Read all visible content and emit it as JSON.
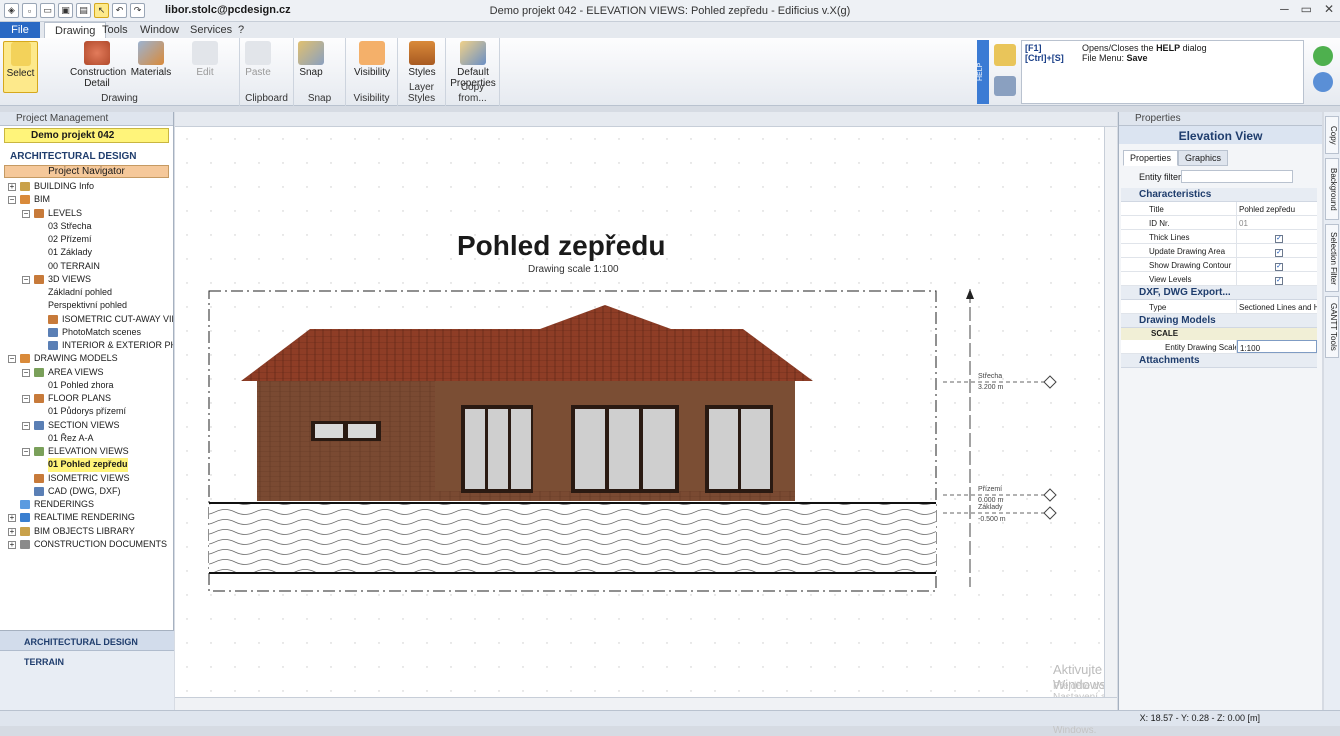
{
  "app": {
    "user": "libor.stolc@pcdesign.cz",
    "window_title": "Demo projekt 042 - ELEVATION VIEWS: Pohled zepředu - Edificius v.X(g)"
  },
  "tabs": [
    "File",
    "Drawing",
    "Tools",
    "Window",
    "Services",
    "?"
  ],
  "ribbon": {
    "select": "Select",
    "construction": "Construction",
    "detail": "Detail",
    "materials": "Materials",
    "edit": "Edit",
    "paste": "Paste",
    "snap": "Snap",
    "visibility": "Visibility",
    "styles": "Styles",
    "default": "Default",
    "properties": "Properties",
    "g_drawing": "Drawing",
    "g_clipboard": "Clipboard",
    "g_snap": "Snap",
    "g_visibility": "Visibility",
    "g_layer": "Layer Styles",
    "g_copy": "Copy from..."
  },
  "help": {
    "strip": "HELP",
    "k1": "[F1]",
    "d1": "Opens/Closes the",
    "d1b": "HELP",
    "d1c": "dialog",
    "k2": "[Ctrl]+[S]",
    "d2": "File Menu:",
    "d2b": "Save"
  },
  "left": {
    "title": "Project Management",
    "project": "Demo projekt 042",
    "section": "ARCHITECTURAL DESIGN",
    "navigator": "Project Navigator",
    "tree": [
      {
        "l": "BUILDING Info",
        "d": 0,
        "e": "+",
        "c": "#c9a14a"
      },
      {
        "l": "BIM",
        "d": 0,
        "e": "−",
        "c": "#d98a3a"
      },
      {
        "l": "LEVELS",
        "d": 1,
        "e": "−",
        "c": "#c77a3a"
      },
      {
        "l": "03 Střecha",
        "d": 2
      },
      {
        "l": "02 Přízemí",
        "d": 2
      },
      {
        "l": "01 Základy",
        "d": 2
      },
      {
        "l": "00 TERRAIN",
        "d": 2
      },
      {
        "l": "3D VIEWS",
        "d": 1,
        "e": "−",
        "c": "#c77a3a"
      },
      {
        "l": "Základní pohled",
        "d": 2
      },
      {
        "l": "Perspektivní pohled",
        "d": 2
      },
      {
        "l": "ISOMETRIC CUT-AWAY VIEWS",
        "d": 2,
        "c": "#c77a3a"
      },
      {
        "l": "PhotoMatch scenes",
        "d": 2,
        "c": "#5a7fb5"
      },
      {
        "l": "INTERIOR & EXTERIOR PHOTO",
        "d": 2,
        "c": "#5a7fb5"
      },
      {
        "l": "DRAWING MODELS",
        "d": 0,
        "e": "−",
        "c": "#d98a3a"
      },
      {
        "l": "AREA VIEWS",
        "d": 1,
        "e": "−",
        "c": "#7aa05a"
      },
      {
        "l": "01 Pohled zhora",
        "d": 2
      },
      {
        "l": "FLOOR PLANS",
        "d": 1,
        "e": "−",
        "c": "#c77a3a"
      },
      {
        "l": "01 Půdorys přízemí",
        "d": 2
      },
      {
        "l": "SECTION VIEWS",
        "d": 1,
        "e": "−",
        "c": "#5a7fb5"
      },
      {
        "l": "01 Řez  A-A",
        "d": 2
      },
      {
        "l": "ELEVATION VIEWS",
        "d": 1,
        "e": "−",
        "c": "#7aa05a"
      },
      {
        "l": "01 Pohled zepředu",
        "d": 2,
        "h": true
      },
      {
        "l": "ISOMETRIC VIEWS",
        "d": 1,
        "c": "#c77a3a"
      },
      {
        "l": "CAD (DWG, DXF)",
        "d": 1,
        "c": "#5a7fb5"
      },
      {
        "l": "RENDERINGS",
        "d": 0,
        "c": "#5a9be0"
      },
      {
        "l": "REALTIME RENDERING",
        "d": 0,
        "e": "+",
        "c": "#3a7fd0"
      },
      {
        "l": "BIM OBJECTS LIBRARY",
        "d": 0,
        "e": "+",
        "c": "#c9a14a"
      },
      {
        "l": "CONSTRUCTION DOCUMENTS",
        "d": 0,
        "e": "+",
        "c": "#8a8a8a"
      }
    ],
    "bottom1": "ARCHITECTURAL DESIGN",
    "bottom2": "TERRAIN"
  },
  "canvas": {
    "title": "Pohled zepředu",
    "scale": "Drawing scale 1:100",
    "lvl1": "Střecha",
    "lvl1v": "3.200 m",
    "lvl2": "Přízemí",
    "lvl2v": "0.000 m",
    "lvl3": "Základy",
    "lvl3v": "-0.500 m",
    "wm1": "Aktivujte Windows",
    "wm2": "Přejděte do Nastavení a aktivujte systém Windows."
  },
  "props": {
    "head": "Properties",
    "title": "Elevation View",
    "tab1": "Properties",
    "tab2": "Graphics",
    "filter": "Entity filter",
    "s1": "Characteristics",
    "r_title": "Title",
    "v_title": "Pohled zepředu",
    "r_id": "ID Nr.",
    "v_id": "01",
    "r_thick": "Thick Lines",
    "r_upd": "Update Drawing Area",
    "r_cont": "Show Drawing Contour",
    "r_lvl": "View Levels",
    "s2": "DXF, DWG Export...",
    "r_type": "Type",
    "v_type": "Sectioned Lines and Hatches",
    "s3": "Drawing Models",
    "sub": "SCALE",
    "r_scale": "Entity Drawing Scale",
    "v_scale": "1:100",
    "s4": "Attachments"
  },
  "side": [
    "Copy",
    "Background",
    "Selection Filter",
    "GANTT Tools"
  ],
  "status": {
    "coords": "X: 18.57 - Y: 0.28 - Z: 0.00 [m]"
  }
}
